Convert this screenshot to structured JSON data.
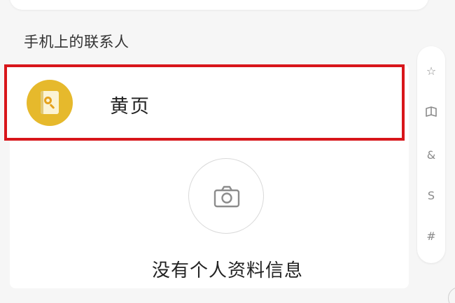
{
  "section": {
    "header": "手机上的联系人"
  },
  "contact": {
    "name": "黄页",
    "avatar_icon": "yellow-pages-icon",
    "highlight_color": "#d8161b",
    "avatar_color": "#e6b92c"
  },
  "profile": {
    "camera_icon": "camera-icon",
    "empty_text": "没有个人资料信息"
  },
  "index_bar": {
    "items": [
      {
        "label": "☆",
        "icon": "star-icon"
      },
      {
        "label": "",
        "icon": "book-icon"
      },
      {
        "label": "&"
      },
      {
        "label": "S"
      },
      {
        "label": "#"
      }
    ]
  }
}
